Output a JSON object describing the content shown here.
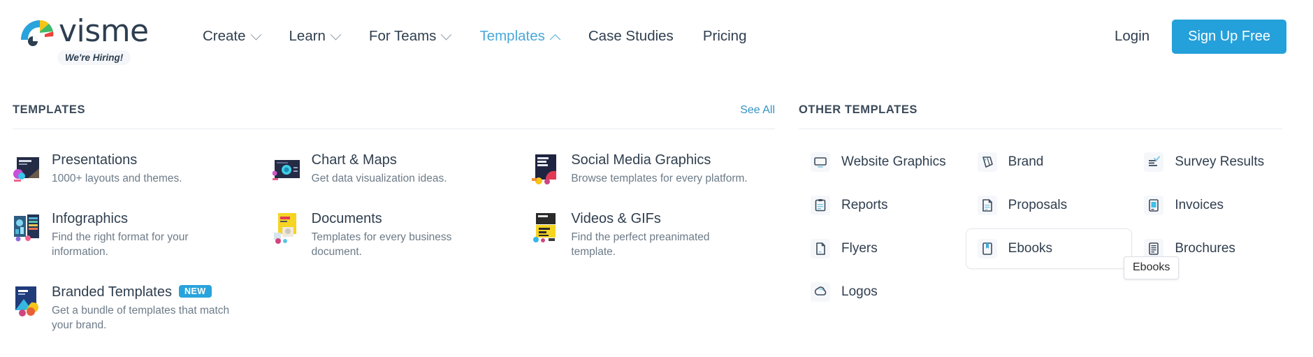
{
  "header": {
    "logo_text": "visme",
    "logo_icon": "visme-fan-logo-icon",
    "hiring_badge": "We're Hiring!",
    "nav": [
      {
        "label": "Create",
        "has_caret": true,
        "active": false,
        "icon": "chevron-down-icon"
      },
      {
        "label": "Learn",
        "has_caret": true,
        "active": false,
        "icon": "chevron-down-icon"
      },
      {
        "label": "For Teams",
        "has_caret": true,
        "active": false,
        "icon": "chevron-down-icon"
      },
      {
        "label": "Templates",
        "has_caret": true,
        "active": true,
        "icon": "chevron-up-icon"
      },
      {
        "label": "Case Studies",
        "has_caret": false,
        "active": false,
        "icon": ""
      },
      {
        "label": "Pricing",
        "has_caret": false,
        "active": false,
        "icon": ""
      }
    ],
    "login_label": "Login",
    "signup_label": "Sign Up Free"
  },
  "templates_section": {
    "title": "TEMPLATES",
    "see_all_label": "See All",
    "items": [
      {
        "title": "Presentations",
        "desc": "1000+ layouts and themes.",
        "thumb": "presentation-thumbnail",
        "badge": ""
      },
      {
        "title": "Chart & Maps",
        "desc": "Get data visualization ideas.",
        "thumb": "chart-thumbnail",
        "badge": ""
      },
      {
        "title": "Social Media Graphics",
        "desc": "Browse templates for every platform.",
        "thumb": "social-thumbnail",
        "badge": ""
      },
      {
        "title": "Infographics",
        "desc": "Find the right format for your information.",
        "thumb": "infographic-thumbnail",
        "badge": ""
      },
      {
        "title": "Documents",
        "desc": "Templates for every business document.",
        "thumb": "document-thumbnail",
        "badge": ""
      },
      {
        "title": "Videos & GIFs",
        "desc": "Find the perfect preanimated template.",
        "thumb": "video-thumbnail",
        "badge": ""
      },
      {
        "title": "Branded Templates",
        "desc": "Get a bundle of templates that match your brand.",
        "thumb": "branded-thumbnail",
        "badge": "NEW"
      }
    ]
  },
  "other_templates_section": {
    "title": "OTHER TEMPLATES",
    "items": [
      {
        "label": "Website Graphics",
        "icon": "monitor-icon",
        "hovered": false
      },
      {
        "label": "Brand",
        "icon": "brand-tag-icon",
        "hovered": false
      },
      {
        "label": "Survey Results",
        "icon": "survey-check-icon",
        "hovered": false
      },
      {
        "label": "Reports",
        "icon": "clipboard-icon",
        "hovered": false
      },
      {
        "label": "Proposals",
        "icon": "document-icon",
        "hovered": false
      },
      {
        "label": "Invoices",
        "icon": "invoice-icon",
        "hovered": false
      },
      {
        "label": "Flyers",
        "icon": "flyer-page-icon",
        "hovered": false
      },
      {
        "label": "Ebooks",
        "icon": "book-icon",
        "hovered": true
      },
      {
        "label": "Brochures",
        "icon": "brochure-icon",
        "hovered": false
      },
      {
        "label": "Logos",
        "icon": "logo-cloud-icon",
        "hovered": false
      }
    ]
  },
  "tooltip": {
    "text": "Ebooks"
  },
  "colors": {
    "accent": "#24a0da",
    "active_nav": "#4aa8d8",
    "link": "#3393c4",
    "text_dark": "#2f3e4e",
    "text_muted": "#6d7b88",
    "badge_new": "#29a3db",
    "rule": "#e8eaed"
  }
}
